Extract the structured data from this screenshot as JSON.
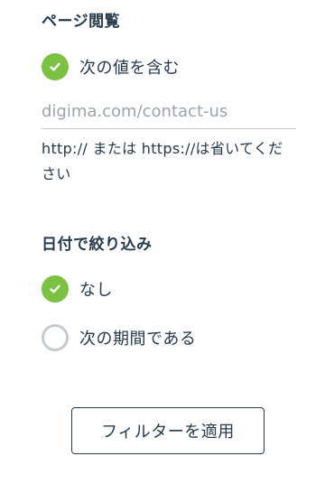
{
  "page_view": {
    "title": "ページ閲覧",
    "contains_option": {
      "label": "次の値を含む",
      "checked": true,
      "icon": "check-icon"
    },
    "url_input": {
      "value": "",
      "placeholder": "digima.com/contact-us"
    },
    "hint": "http:// または https://は省いてください"
  },
  "date_filter": {
    "title": "日付で絞り込み",
    "options": [
      {
        "label": "なし",
        "checked": true,
        "icon": "check-icon"
      },
      {
        "label": "次の期間である",
        "checked": false
      }
    ]
  },
  "apply_button": {
    "label": "フィルターを適用"
  },
  "colors": {
    "accent_green": "#7cc242",
    "text_dark": "#253b4b",
    "placeholder_gray": "#9aa5ad",
    "radio_border": "#c4ccd2"
  }
}
